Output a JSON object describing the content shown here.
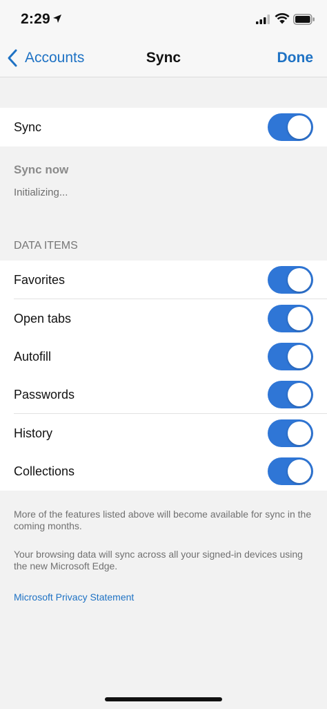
{
  "status_bar": {
    "time": "2:29",
    "icons": [
      "location-arrow-icon",
      "cellular-signal-icon",
      "wifi-icon",
      "battery-icon"
    ]
  },
  "nav": {
    "back_label": "Accounts",
    "title": "Sync",
    "done_label": "Done"
  },
  "sync": {
    "label": "Sync",
    "enabled": true
  },
  "sync_now": {
    "label": "Sync now",
    "status": "Initializing..."
  },
  "data_items": {
    "header": "DATA ITEMS",
    "items": [
      {
        "label": "Favorites",
        "enabled": true
      },
      {
        "label": "Open tabs",
        "enabled": true
      },
      {
        "label": "Autofill",
        "enabled": true
      },
      {
        "label": "Passwords",
        "enabled": true
      },
      {
        "label": "History",
        "enabled": true
      },
      {
        "label": "Collections",
        "enabled": true
      }
    ]
  },
  "footer": {
    "note1": "More of the features listed above will become available for sync in the coming months.",
    "note2": "Your browsing data will sync across all your signed-in devices using the new Microsoft Edge.",
    "privacy_link": "Microsoft Privacy Statement"
  },
  "colors": {
    "accent": "#1e72c4",
    "toggle_on": "#2f76d6",
    "background": "#f2f2f2"
  }
}
